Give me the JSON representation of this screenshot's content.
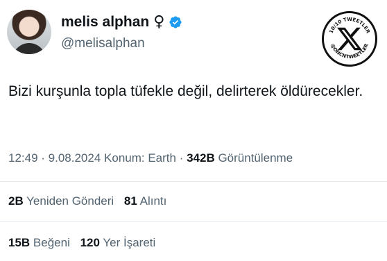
{
  "user": {
    "display_name": "melis alphan",
    "gender_symbol": "♀",
    "handle": "@melisalphan",
    "verified_color": "#1d9bf0"
  },
  "badge": {
    "top_text": "10/10 TWEETLER",
    "bottom_text": "@ONCNTWEETLER",
    "icon": "x-logo-icon"
  },
  "tweet": {
    "text": "Bizi kurşunla topla tüfekle değil, delirterek öldürecekler."
  },
  "meta": {
    "time": "12:49",
    "sep1": " · ",
    "date": "9.08.2024",
    "location": " Konum: Earth",
    "sep2": " · ",
    "views": "342B",
    "views_label": " Görüntülenme"
  },
  "stats": {
    "reposts": "2B",
    "reposts_label": "Yeniden Gönderi",
    "quotes": "81",
    "quotes_label": "Alıntı",
    "likes": "15B",
    "likes_label": "Beğeni",
    "bookmarks": "120",
    "bookmarks_label": "Yer İşareti"
  }
}
